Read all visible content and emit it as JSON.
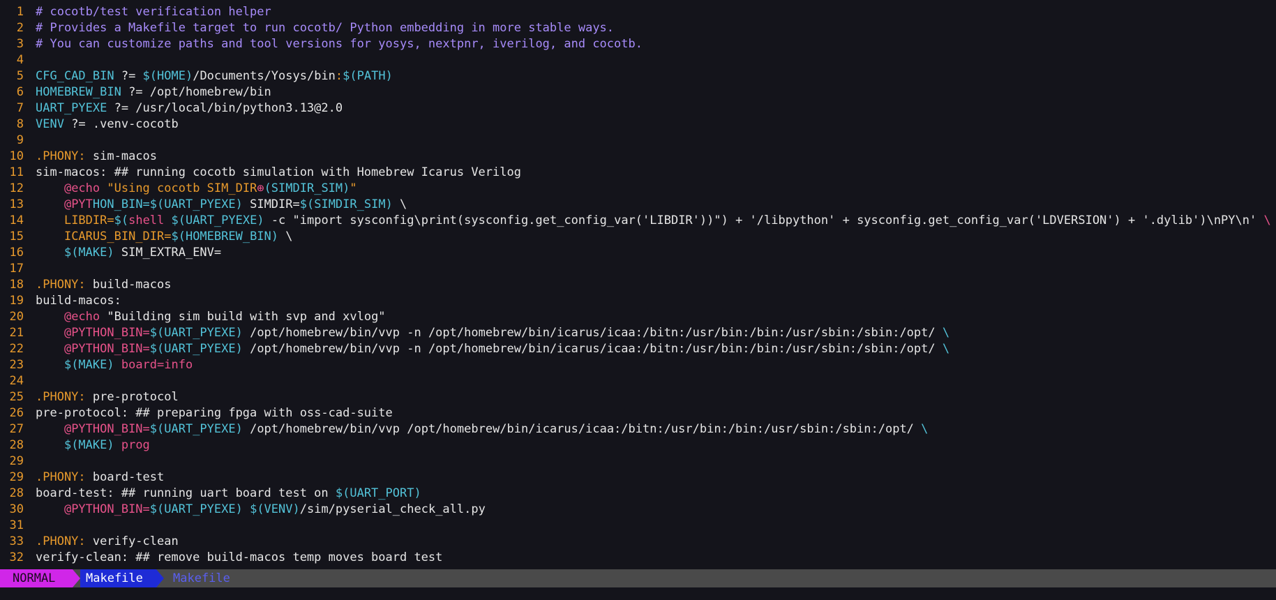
{
  "colors": {
    "background": "#14141b",
    "line_number": "#e89a2c",
    "text": "#e6e6e6",
    "comment": "#a78bfa",
    "variable": "#53c3d9",
    "operator": "#e89a2c",
    "string": "#e89a2c",
    "at_sign": "#e8528a",
    "mode_bg": "#d026e8",
    "file_bg": "#1e2bd6",
    "statusline_bg": "#4a4a4a"
  },
  "editor": {
    "lines": [
      {
        "num": "1",
        "segments": [
          {
            "text": "# cocotb/test verification helper",
            "color": "#a78bfa"
          }
        ]
      },
      {
        "num": "2",
        "segments": [
          {
            "text": "# Provides a Makefile target to run cocotb/ Python embedding in more stable ways.",
            "color": "#a78bfa"
          }
        ]
      },
      {
        "num": "3",
        "segments": [
          {
            "text": "# You can customize paths and tool versions for yosys, nextpnr, iverilog, and cocotb.",
            "color": "#a78bfa"
          }
        ]
      },
      {
        "num": "4",
        "segments": []
      },
      {
        "num": "5",
        "segments": [
          {
            "text": "CFG_CAD_BIN",
            "color": "#53c3d9"
          },
          {
            "text": " ?= ",
            "color": "#e6e6e6"
          },
          {
            "text": "$(HOME)",
            "color": "#53c3d9"
          },
          {
            "text": "/Documents/Yosys/bin",
            "color": "#e6e6e6"
          },
          {
            "text": ":",
            "color": "#e89a2c"
          },
          {
            "text": "$(PATH)",
            "color": "#53c3d9"
          }
        ]
      },
      {
        "num": "6",
        "segments": [
          {
            "text": "HOMEBREW_BIN",
            "color": "#53c3d9"
          },
          {
            "text": " ?= /opt/homebrew/bin",
            "color": "#e6e6e6"
          }
        ]
      },
      {
        "num": "7",
        "segments": [
          {
            "text": "UART_PYEXE",
            "color": "#53c3d9"
          },
          {
            "text": " ?= /usr/local/bin/python3.13@2.0",
            "color": "#e6e6e6"
          }
        ]
      },
      {
        "num": "8",
        "segments": [
          {
            "text": "VENV",
            "color": "#53c3d9"
          },
          {
            "text": " ?= .venv-cocotb",
            "color": "#e6e6e6"
          }
        ]
      },
      {
        "num": "9",
        "segments": []
      },
      {
        "num": "10",
        "segments": [
          {
            "text": ".PHONY:",
            "color": "#e89a2c"
          },
          {
            "text": " sim-macos",
            "color": "#e6e6e6"
          }
        ]
      },
      {
        "num": "11",
        "segments": [
          {
            "text": "sim-macos: ## running cocotb simulation with Homebrew Icarus Verilog",
            "color": "#e6e6e6"
          }
        ]
      },
      {
        "num": "12",
        "segments": [
          {
            "text": "    ",
            "color": "#e6e6e6"
          },
          {
            "text": "@echo",
            "color": "#e8528a"
          },
          {
            "text": " \"Using cocotb SIM_DIR",
            "color": "#e89a2c"
          },
          {
            "text": "⊕",
            "color": "#e8528a"
          },
          {
            "text": "(SIMDIR_SIM)",
            "color": "#53c3d9"
          },
          {
            "text": "\"",
            "color": "#e89a2c"
          }
        ]
      },
      {
        "num": "13",
        "segments": [
          {
            "text": "    ",
            "color": "#e6e6e6"
          },
          {
            "text": "@PYT",
            "color": "#e8528a"
          },
          {
            "text": "HON_BIN=",
            "color": "#53c3d9"
          },
          {
            "text": "$(UART_PYEXE)",
            "color": "#53c3d9"
          },
          {
            "text": " SIMDIR=",
            "color": "#e6e6e6"
          },
          {
            "text": "$(SIMDIR_SIM)",
            "color": "#53c3d9"
          },
          {
            "text": " \\",
            "color": "#e6e6e6"
          }
        ]
      },
      {
        "num": "14",
        "segments": [
          {
            "text": "    ",
            "color": "#e6e6e6"
          },
          {
            "text": "LIBDIR=",
            "color": "#e89a2c"
          },
          {
            "text": "$(",
            "color": "#53c3d9"
          },
          {
            "text": "shell",
            "color": "#e8528a"
          },
          {
            "text": " $(UART_PYEXE)",
            "color": "#53c3d9"
          },
          {
            "text": " -c \"import sysconfig\\print(sysconfig.get_config_var('LIBDIR'))\") + '/libpython' + sysconfig.get_config_var('LDVERSION') + '.dylib')\\nPY\\n' ",
            "color": "#e6e6e6"
          },
          {
            "text": "\\",
            "color": "#e8528a"
          }
        ]
      },
      {
        "num": "15",
        "segments": [
          {
            "text": "    ",
            "color": "#e6e6e6"
          },
          {
            "text": "ICARUS_BIN_DIR=",
            "color": "#e89a2c"
          },
          {
            "text": "$(HOMEBREW_BIN)",
            "color": "#53c3d9"
          },
          {
            "text": " \\",
            "color": "#e6e6e6"
          }
        ]
      },
      {
        "num": "16",
        "segments": [
          {
            "text": "    ",
            "color": "#e6e6e6"
          },
          {
            "text": "$(MAKE)",
            "color": "#53c3d9"
          },
          {
            "text": " SIM_EXTRA_ENV=",
            "color": "#e6e6e6"
          }
        ]
      },
      {
        "num": "17",
        "segments": []
      },
      {
        "num": "18",
        "segments": [
          {
            "text": ".PHONY:",
            "color": "#e89a2c"
          },
          {
            "text": " build-macos",
            "color": "#e6e6e6"
          }
        ]
      },
      {
        "num": "19",
        "segments": [
          {
            "text": "build-macos:",
            "color": "#e6e6e6"
          }
        ]
      },
      {
        "num": "20",
        "segments": [
          {
            "text": "    ",
            "color": "#e6e6e6"
          },
          {
            "text": "@echo",
            "color": "#e8528a"
          },
          {
            "text": " \"Building sim build with svp and xvlog\"",
            "color": "#e6e6e6"
          }
        ]
      },
      {
        "num": "21",
        "segments": [
          {
            "text": "    ",
            "color": "#e6e6e6"
          },
          {
            "text": "@PYTHON_BIN=",
            "color": "#e8528a"
          },
          {
            "text": "$(UART_PYEXE)",
            "color": "#53c3d9"
          },
          {
            "text": " /opt/homebrew/bin/vvp -n /opt/homebrew/bin/icarus/icaa:/bitn:/usr/bin:/bin:/usr/sbin:/sbin:/opt/ ",
            "color": "#e6e6e6"
          },
          {
            "text": "\\",
            "color": "#53c3d9"
          }
        ]
      },
      {
        "num": "22",
        "segments": [
          {
            "text": "    ",
            "color": "#e6e6e6"
          },
          {
            "text": "@PYTHON_BIN=",
            "color": "#e8528a"
          },
          {
            "text": "$(UART_PYEXE)",
            "color": "#53c3d9"
          },
          {
            "text": " /opt/homebrew/bin/vvp -n /opt/homebrew/bin/icarus/icaa:/bitn:/usr/bin:/bin:/usr/sbin:/sbin:/opt/ ",
            "color": "#e6e6e6"
          },
          {
            "text": "\\",
            "color": "#53c3d9"
          }
        ]
      },
      {
        "num": "23",
        "segments": [
          {
            "text": "    ",
            "color": "#e6e6e6"
          },
          {
            "text": "$(MAKE)",
            "color": "#53c3d9"
          },
          {
            "text": " board=info",
            "color": "#e8528a"
          }
        ]
      },
      {
        "num": "24",
        "segments": []
      },
      {
        "num": "25",
        "segments": [
          {
            "text": ".PHONY:",
            "color": "#e89a2c"
          },
          {
            "text": " pre-protocol",
            "color": "#e6e6e6"
          }
        ]
      },
      {
        "num": "26",
        "segments": [
          {
            "text": "pre-protocol: ## preparing fpga with oss-cad-suite",
            "color": "#e6e6e6"
          }
        ]
      },
      {
        "num": "27",
        "segments": [
          {
            "text": "    ",
            "color": "#e6e6e6"
          },
          {
            "text": "@PYTHON_BIN=",
            "color": "#e8528a"
          },
          {
            "text": "$(UART_PYEXE)",
            "color": "#53c3d9"
          },
          {
            "text": " /opt/homebrew/bin/vvp /opt/homebrew/bin/icarus/icaa:/bitn:/usr/bin:/bin:/usr/sbin:/sbin:/opt/ ",
            "color": "#e6e6e6"
          },
          {
            "text": "\\",
            "color": "#53c3d9"
          }
        ]
      },
      {
        "num": "28",
        "segments": [
          {
            "text": "    ",
            "color": "#e6e6e6"
          },
          {
            "text": "$(MAKE)",
            "color": "#53c3d9"
          },
          {
            "text": " prog",
            "color": "#e8528a"
          }
        ]
      },
      {
        "num": "29",
        "segments": []
      },
      {
        "num": "29",
        "segments": [
          {
            "text": ".PHONY:",
            "color": "#e89a2c"
          },
          {
            "text": " board-test",
            "color": "#e6e6e6"
          }
        ]
      },
      {
        "num": "28",
        "segments": [
          {
            "text": "board-test: ## running uart board test on ",
            "color": "#e6e6e6"
          },
          {
            "text": "$(UART_PORT)",
            "color": "#53c3d9"
          }
        ]
      },
      {
        "num": "30",
        "segments": [
          {
            "text": "    ",
            "color": "#e6e6e6"
          },
          {
            "text": "@PYTHON_BIN=",
            "color": "#e8528a"
          },
          {
            "text": "$(UART_PYEXE)",
            "color": "#53c3d9"
          },
          {
            "text": " $(VENV)",
            "color": "#53c3d9"
          },
          {
            "text": "/sim/pyserial_check_all.py",
            "color": "#e6e6e6"
          }
        ]
      },
      {
        "num": "31",
        "segments": []
      },
      {
        "num": "33",
        "segments": [
          {
            "text": ".PHONY:",
            "color": "#e89a2c"
          },
          {
            "text": " verify-clean",
            "color": "#e6e6e6"
          }
        ]
      },
      {
        "num": "32",
        "segments": [
          {
            "text": "verify-clean: ## remove build-macos temp moves board test",
            "color": "#e6e6e6"
          }
        ]
      }
    ]
  },
  "statusline": {
    "mode": "NORMAL",
    "filename": "Makefile",
    "filetype": "Makefile"
  }
}
